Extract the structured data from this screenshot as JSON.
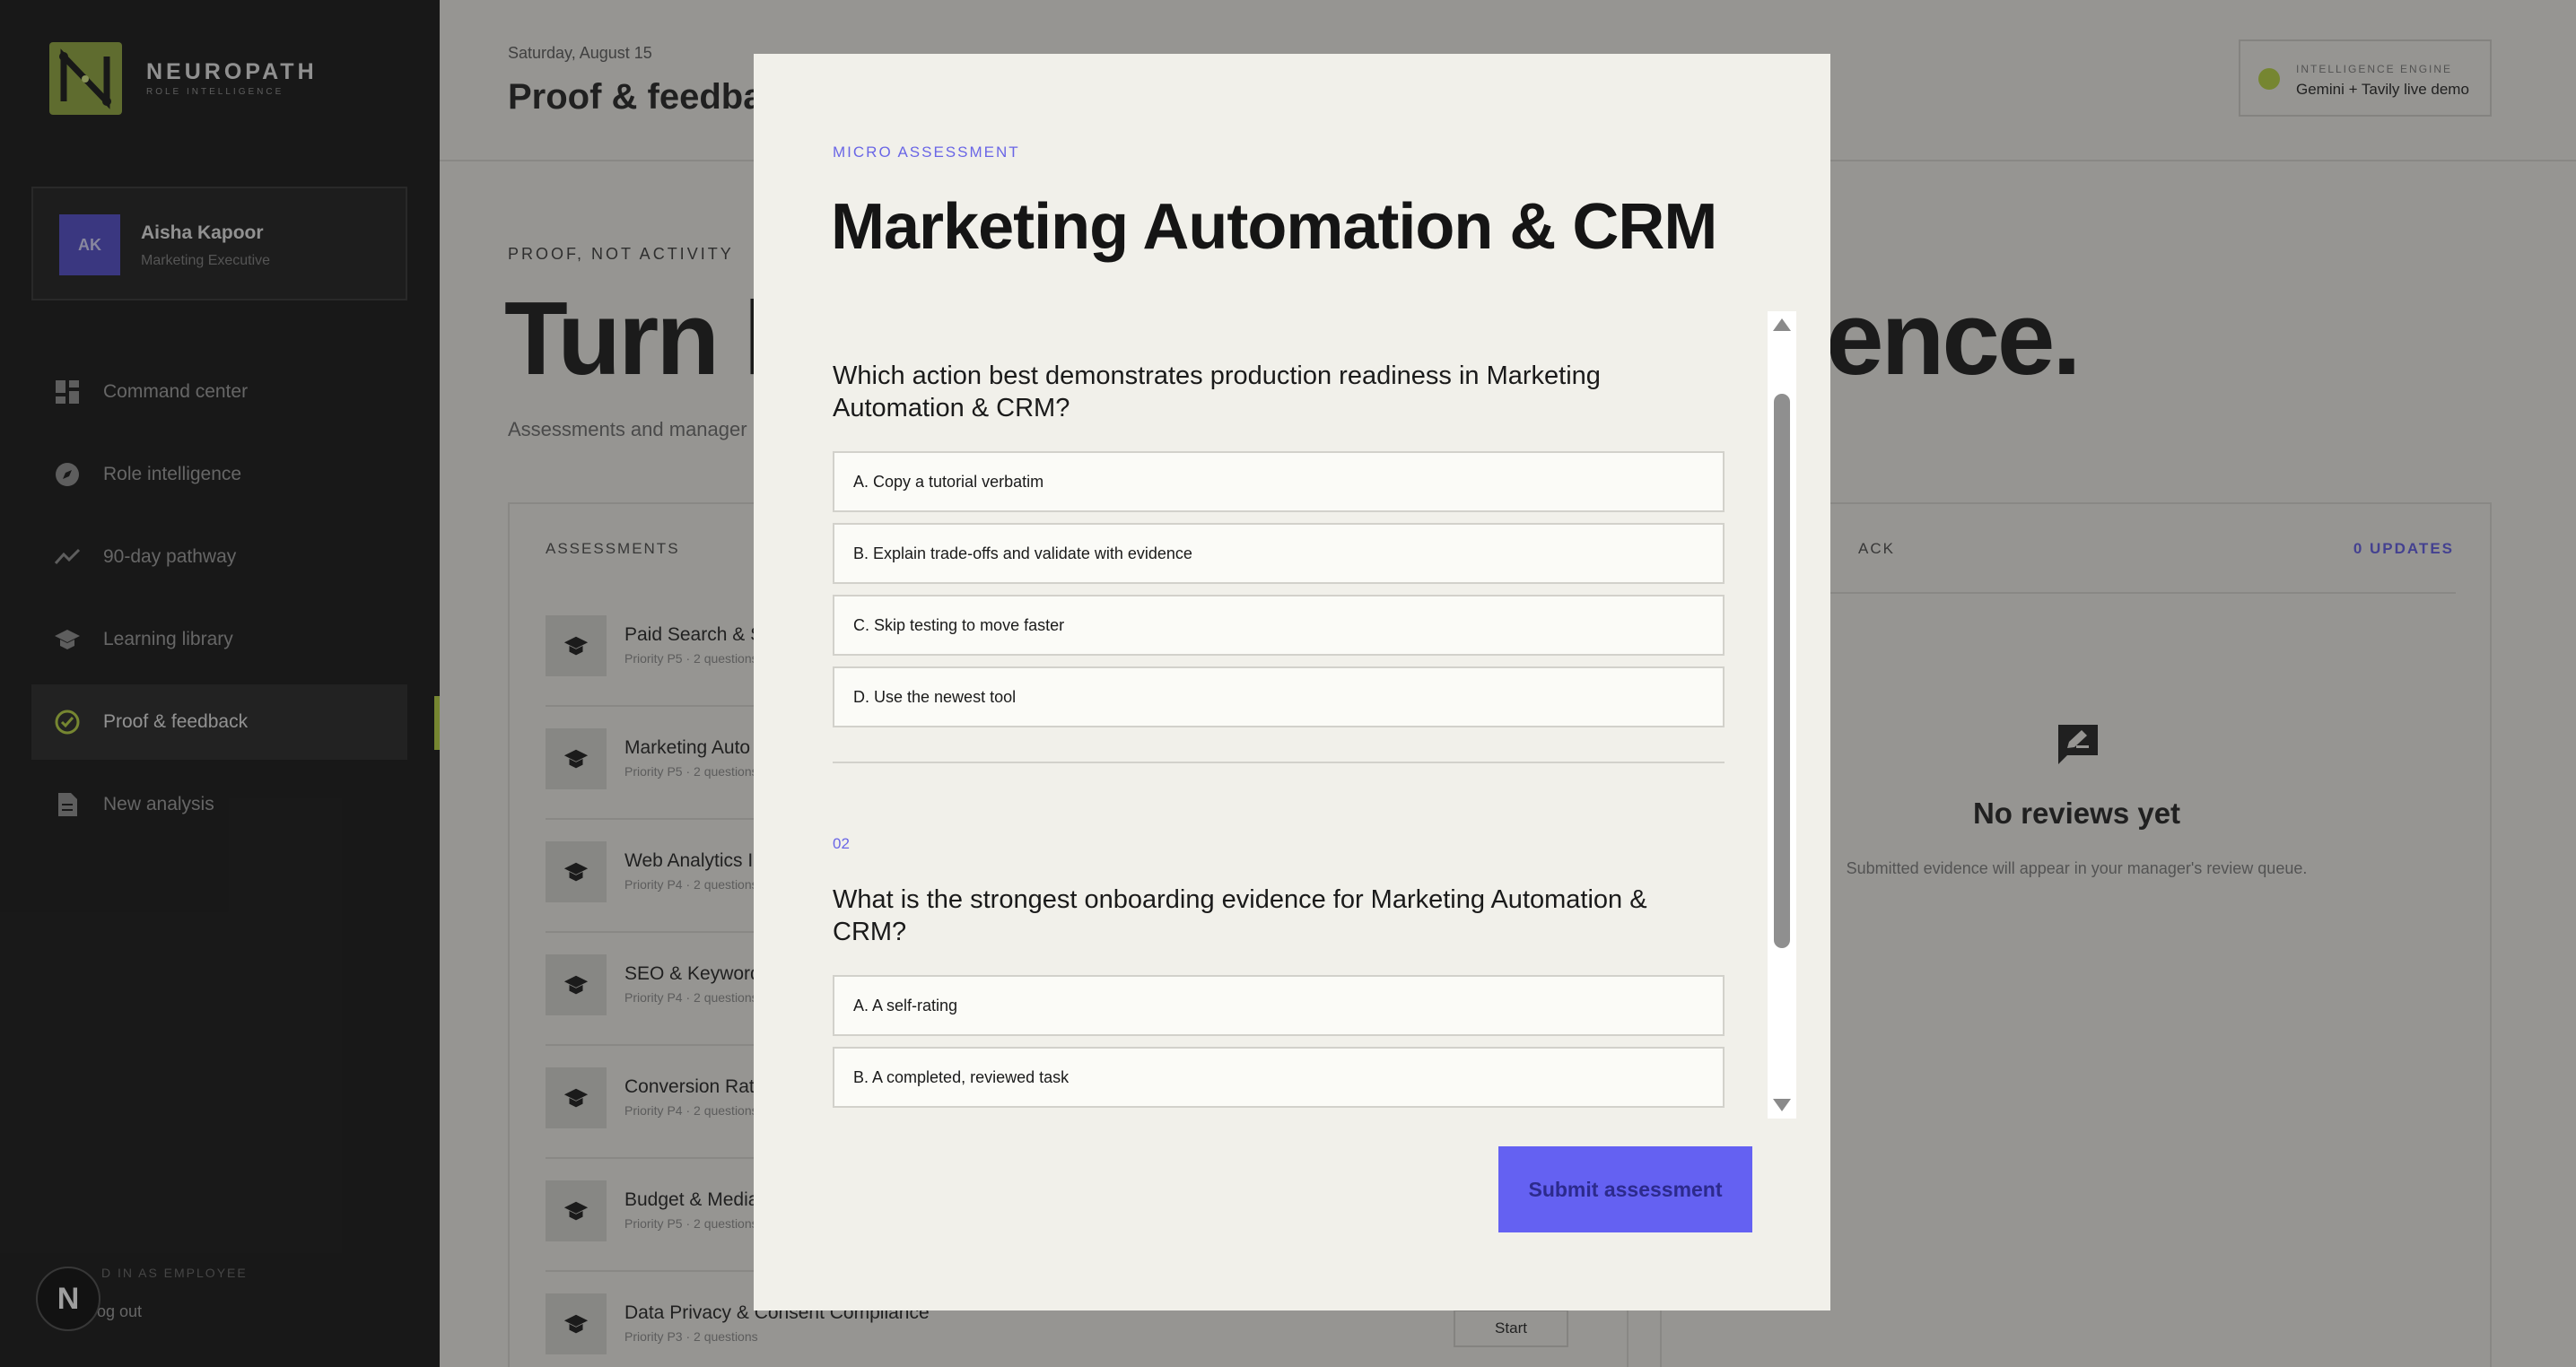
{
  "brand": {
    "name": "NEUROPATH",
    "sub": "ROLE INTELLIGENCE"
  },
  "user": {
    "initials": "AK",
    "name": "Aisha Kapoor",
    "role": "Marketing Executive"
  },
  "nav": [
    {
      "label": "Command center",
      "icon": "dashboard-icon"
    },
    {
      "label": "Role intelligence",
      "icon": "compass-icon"
    },
    {
      "label": "90-day pathway",
      "icon": "trend-icon"
    },
    {
      "label": "Learning library",
      "icon": "graduation-cap-icon"
    },
    {
      "label": "Proof & feedback",
      "icon": "check-circle-icon",
      "active": true
    },
    {
      "label": "New analysis",
      "icon": "document-icon"
    }
  ],
  "footer": {
    "signed_in": "D IN AS EMPLOYEE",
    "logout": "og out",
    "badge": "N"
  },
  "header": {
    "date": "Saturday, August 15",
    "title": "Proof & feedba",
    "engine_label": "INTELLIGENCE ENGINE",
    "engine_value": "Gemini + Tavily live demo"
  },
  "hero": {
    "kicker": "PROOF, NOT ACTIVITY",
    "left": "Turn l",
    "right": "ence.",
    "subline": "Assessments and manager"
  },
  "assessments": {
    "label": "ASSESSMENTS",
    "items": [
      {
        "title": "Paid Search & S",
        "meta": "Priority P5 · 2 questions"
      },
      {
        "title": "Marketing Auto",
        "meta": "Priority P5 · 2 questions"
      },
      {
        "title": "Web Analytics I",
        "meta": "Priority P4 · 2 questions"
      },
      {
        "title": "SEO & Keyword",
        "meta": "Priority P4 · 2 questions"
      },
      {
        "title": "Conversion Rat",
        "meta": "Priority P4 · 2 questions"
      },
      {
        "title": "Budget & Media",
        "meta": "Priority P5 · 2 questions"
      },
      {
        "title": "Data Privacy & Consent Compliance",
        "meta": "Priority P3 · 2 questions"
      }
    ],
    "start_label": "Start"
  },
  "feedback": {
    "label": "ACK",
    "updates": "0 UPDATES",
    "empty_title": "No reviews yet",
    "empty_sub": "Submitted evidence will appear in your manager's review queue."
  },
  "modal": {
    "kicker": "MICRO ASSESSMENT",
    "title": "Marketing Automation & CRM",
    "questions": [
      {
        "number": "",
        "text": "Which action best demonstrates production readiness in Marketing Automation & CRM?",
        "options": [
          "A. Copy a tutorial verbatim",
          "B. Explain trade-offs and validate with evidence",
          "C. Skip testing to move faster",
          "D. Use the newest tool"
        ]
      },
      {
        "number": "02",
        "text": "What is the strongest onboarding evidence for Marketing Automation & CRM?",
        "options": [
          "A. A self-rating",
          "B. A completed, reviewed task",
          ""
        ]
      }
    ],
    "submit_label": "Submit assessment"
  },
  "colors": {
    "accent": "#6461f2",
    "brand": "#8da535",
    "highlight": "#b6d43a"
  }
}
